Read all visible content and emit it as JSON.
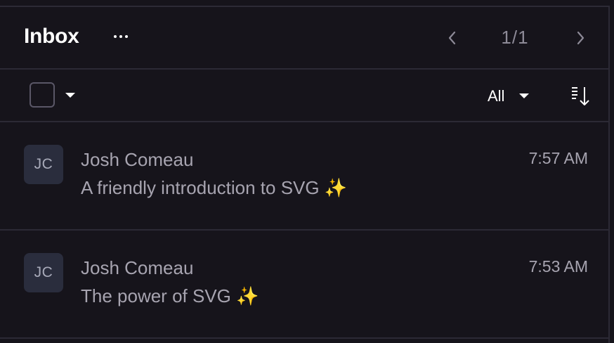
{
  "header": {
    "title": "Inbox",
    "more_icon": "ellipsis-icon",
    "pager": {
      "prev_icon": "chevron-left-icon",
      "next_icon": "chevron-right-icon",
      "count": "1/1"
    }
  },
  "toolbar": {
    "select_all_icon": "checkbox-icon",
    "select_menu_icon": "caret-down-icon",
    "filter_label": "All",
    "filter_icon": "caret-down-icon",
    "sort_icon": "sort-descending-icon"
  },
  "messages": [
    {
      "avatar_initials": "JC",
      "sender": "Josh Comeau",
      "subject": "A friendly introduction to SVG",
      "emoji": "✨",
      "time": "7:57 AM"
    },
    {
      "avatar_initials": "JC",
      "sender": "Josh Comeau",
      "subject": "The power of SVG",
      "emoji": "✨",
      "time": "7:53 AM"
    }
  ],
  "colors": {
    "background": "#16141b",
    "divider": "#2c2a35",
    "avatar_bg": "#2a2d3d",
    "muted_text": "#a7a4b0"
  }
}
